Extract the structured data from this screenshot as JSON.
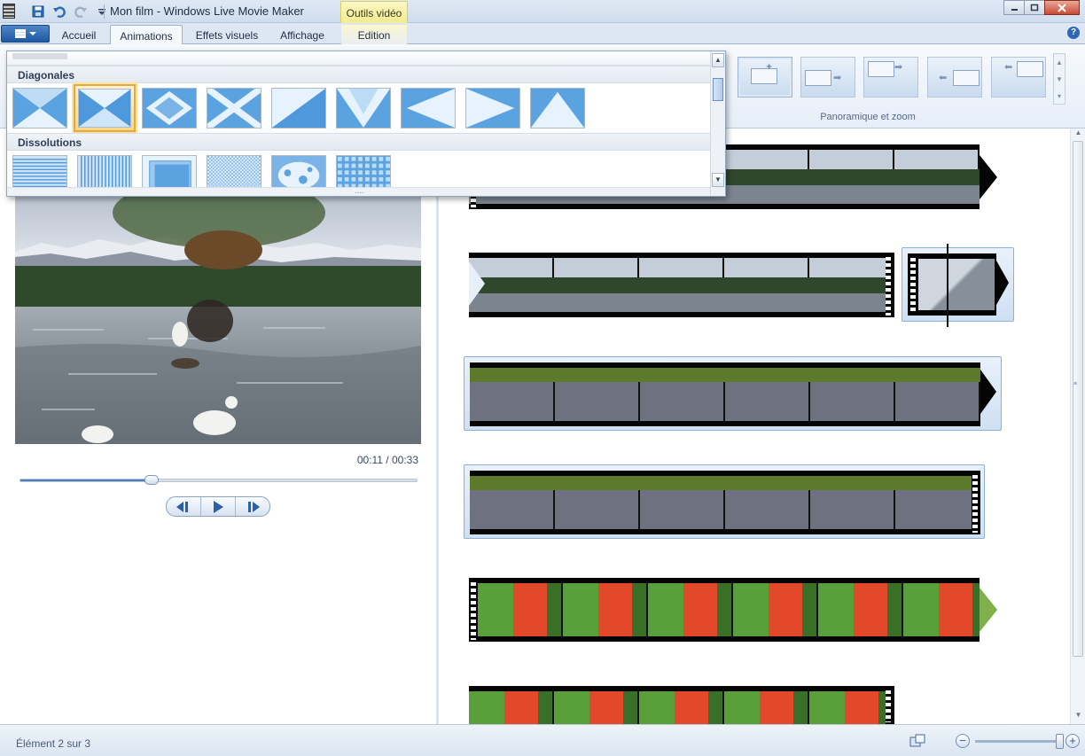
{
  "window": {
    "title": "Mon film - Windows Live Movie Maker"
  },
  "contextual_tab_group": "Outils vidéo",
  "tabs": [
    {
      "label": "Accueil"
    },
    {
      "label": "Animations"
    },
    {
      "label": "Effets visuels"
    },
    {
      "label": "Affichage"
    },
    {
      "label": "Edition"
    }
  ],
  "active_tab": "Animations",
  "ribbon": {
    "pan_zoom_group_label": "Panoramique et zoom"
  },
  "gallery": {
    "sections": [
      {
        "label": "Diagonales",
        "items": [
          "diag-1",
          "diag-2",
          "diag-3",
          "diag-4",
          "diag-5",
          "diag-6",
          "diag-7",
          "diag-8",
          "diag-9"
        ],
        "selected_index": 1
      },
      {
        "label": "Dissolutions",
        "items": [
          "diss-1",
          "diss-2",
          "diss-3",
          "diss-4",
          "diss-5",
          "diss-6"
        ]
      }
    ]
  },
  "player": {
    "time_readout": "00:11 / 00:33",
    "position_fraction": 0.33
  },
  "status": {
    "text": "Élément 2 sur 3"
  },
  "zoom": {
    "level_fraction": 1.0
  },
  "colors": {
    "accent": "#1f58a2",
    "selection_orange": "#e8a93a",
    "contextual_yellow": "#f2ea8a"
  }
}
